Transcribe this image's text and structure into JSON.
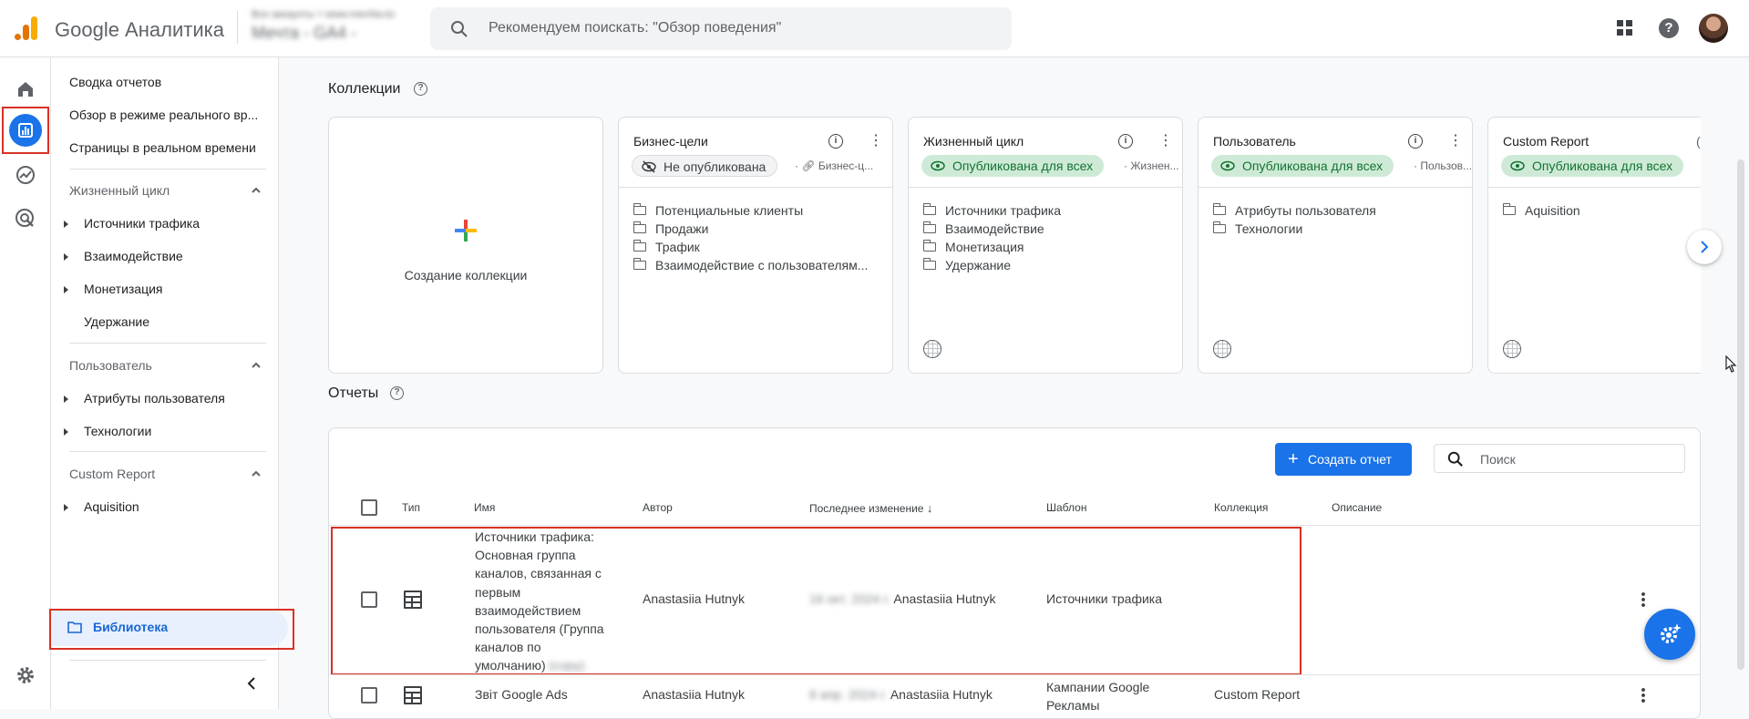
{
  "header": {
    "app_title": "Google Аналитика",
    "account_line1": "Все аккаунты > www.mechta.kz",
    "account_line2": "Мечта - GA4 -",
    "search_placeholder": "Рекомендуем поискать: \"Обзор поведения\""
  },
  "sidebar": {
    "items": [
      {
        "label": "Сводка отчетов"
      },
      {
        "label": "Обзор в режиме реального вр..."
      },
      {
        "label": "Страницы в реальном времени"
      }
    ],
    "sections": [
      {
        "title": "Жизненный цикл",
        "items": [
          "Источники трафика",
          "Взаимодействие",
          "Монетизация",
          "Удержание"
        ]
      },
      {
        "title": "Пользователь",
        "items": [
          "Атрибуты пользователя",
          "Технологии"
        ]
      },
      {
        "title": "Custom Report",
        "items": [
          "Aquisition"
        ]
      }
    ],
    "library": "Библиотека"
  },
  "collections": {
    "title": "Коллекции",
    "create_label": "Создание коллекции",
    "cards": [
      {
        "title": "Бизнес-цели",
        "status": "Не опубликована",
        "template": "Бизнес-ц...",
        "folders": [
          "Потенциальные клиенты",
          "Продажи",
          "Трафик",
          "Взаимодействие с пользователям..."
        ]
      },
      {
        "title": "Жизненный цикл",
        "status": "Опубликована для всех",
        "template": "Жизнен...",
        "folders": [
          "Источники трафика",
          "Взаимодействие",
          "Монетизация",
          "Удержание"
        ]
      },
      {
        "title": "Пользователь",
        "status": "Опубликована для всех",
        "template": "Пользов...",
        "folders": [
          "Атрибуты пользователя",
          "Технологии"
        ]
      },
      {
        "title": "Custom Report",
        "status": "Опубликована для всех",
        "template": "",
        "folders": [
          "Aquisition"
        ]
      }
    ]
  },
  "reports": {
    "title": "Отчеты",
    "create_button": "Создать отчет",
    "search_placeholder": "Поиск",
    "columns": [
      "Тип",
      "Имя",
      "Автор",
      "Последнее изменение",
      "Шаблон",
      "Коллекция",
      "Описание"
    ],
    "rows": [
      {
        "name_lines": [
          "Источники трафика:",
          "Основная группа",
          "каналов, связанная с",
          "первым",
          "взаимодействием",
          "пользователя (Группа",
          "каналов по",
          "умолчанию)"
        ],
        "name_suffix": "(copy)",
        "author": "Anastasiia Hutnyk",
        "modified_date": "16 окт. 2024 г.",
        "modified_by": "Anastasiia Hutnyk",
        "template": "Источники трафика",
        "collection": ""
      },
      {
        "name_lines": [
          "Звіт Google Ads"
        ],
        "name_suffix": "",
        "author": "Anastasiia Hutnyk",
        "modified_date": "8 апр. 2024 г.",
        "modified_by": "Anastasiia Hutnyk",
        "template_lines": [
          "Кампании Google",
          "Рекламы"
        ],
        "collection": "Custom Report"
      }
    ]
  },
  "colors": {
    "accent": "#1a73e8",
    "highlight": "#d93025",
    "published_bg": "#ceead6",
    "published_fg": "#137333"
  }
}
